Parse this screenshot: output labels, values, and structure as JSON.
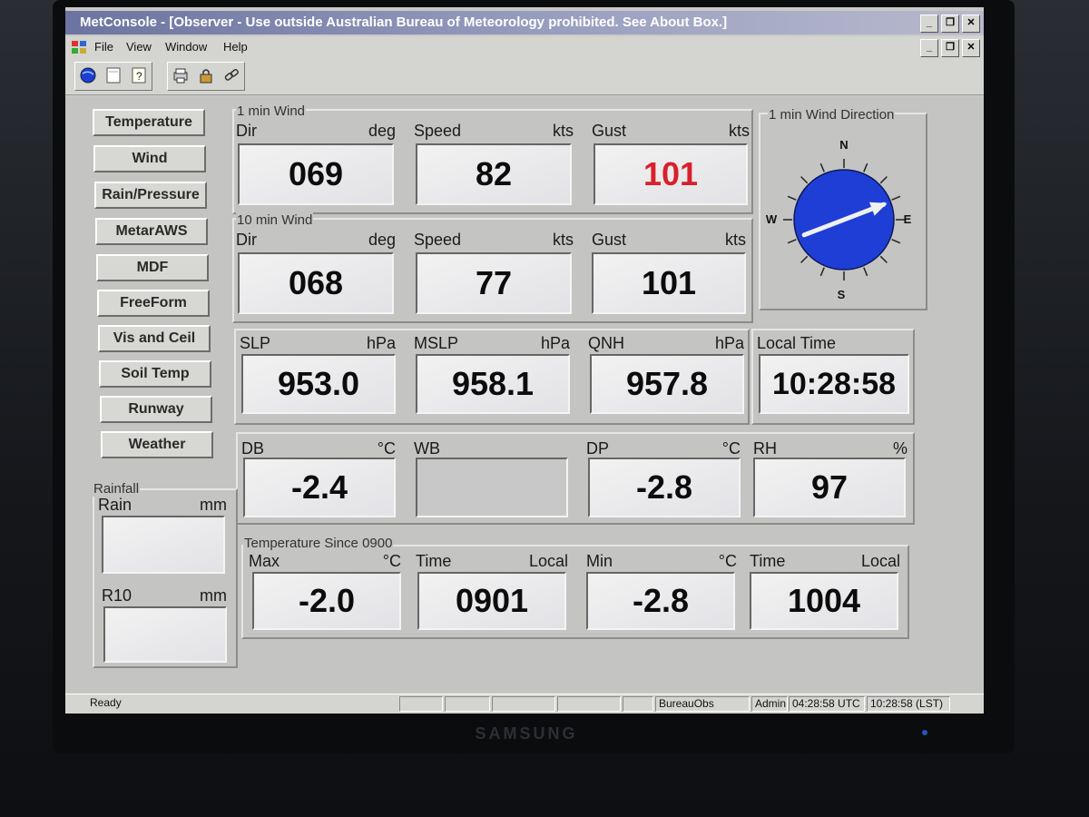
{
  "window": {
    "title": "MetConsole - [Observer - Use outside Australian Bureau of Meteorology prohibited. See About Box.]"
  },
  "menu": [
    "File",
    "View",
    "Window",
    "Help"
  ],
  "toolbar": {
    "icons": [
      "globe-icon",
      "blank-doc-icon",
      "help-question-icon",
      "printer-icon",
      "lock-icon",
      "link-icon"
    ]
  },
  "nav": [
    "Temperature",
    "Wind",
    "Rain/Pressure",
    "MetarAWS",
    "MDF",
    "FreeForm",
    "Vis and Ceil",
    "Soil Temp",
    "Runway",
    "Weather"
  ],
  "wind1": {
    "title": "1 min Wind",
    "dir": {
      "label": "Dir",
      "unit": "deg",
      "value": "069"
    },
    "speed": {
      "label": "Speed",
      "unit": "kts",
      "value": "82"
    },
    "gust": {
      "label": "Gust",
      "unit": "kts",
      "value": "101"
    }
  },
  "wind10": {
    "title": "10 min Wind",
    "dir": {
      "label": "Dir",
      "unit": "deg",
      "value": "068"
    },
    "speed": {
      "label": "Speed",
      "unit": "kts",
      "value": "77"
    },
    "gust": {
      "label": "Gust",
      "unit": "kts",
      "value": "101"
    }
  },
  "compass": {
    "title": "1 min Wind Direction",
    "n": "N",
    "e": "E",
    "s": "S",
    "w": "W",
    "direction_deg": 69,
    "fill": "#1e3ed6"
  },
  "pressure": {
    "slp": {
      "label": "SLP",
      "unit": "hPa",
      "value": "953.0"
    },
    "mslp": {
      "label": "MSLP",
      "unit": "hPa",
      "value": "958.1"
    },
    "qnh": {
      "label": "QNH",
      "unit": "hPa",
      "value": "957.8"
    }
  },
  "local_time": {
    "label": "Local Time",
    "value": "10:28:58"
  },
  "temps": {
    "db": {
      "label": "DB",
      "unit": "°C",
      "value": "-2.4"
    },
    "wb": {
      "label": "WB",
      "unit": "",
      "value": ""
    },
    "dp": {
      "label": "DP",
      "unit": "°C",
      "value": "-2.8"
    },
    "rh": {
      "label": "RH",
      "unit": "%",
      "value": "97"
    }
  },
  "rainfall": {
    "title": "Rainfall",
    "rain": {
      "label": "Rain",
      "unit": "mm",
      "value": ""
    },
    "r10": {
      "label": "R10",
      "unit": "mm",
      "value": ""
    }
  },
  "since0900": {
    "title": "Temperature Since 0900",
    "max": {
      "label": "Max",
      "unit": "°C",
      "value": "-2.0"
    },
    "max_time": {
      "label": "Time",
      "unit": "Local",
      "value": "0901"
    },
    "min": {
      "label": "Min",
      "unit": "°C",
      "value": "-2.8"
    },
    "min_time": {
      "label": "Time",
      "unit": "Local",
      "value": "1004"
    }
  },
  "status": {
    "ready": "Ready",
    "station": "BureauObs",
    "user": "Admin",
    "utc": "04:28:58 UTC",
    "lst": "10:28:58 (LST)"
  },
  "monitor": {
    "brand": "SAMSUNG"
  },
  "colors": {
    "gust_highlight": "#d8202a",
    "title_bar": "#7a82aa"
  }
}
